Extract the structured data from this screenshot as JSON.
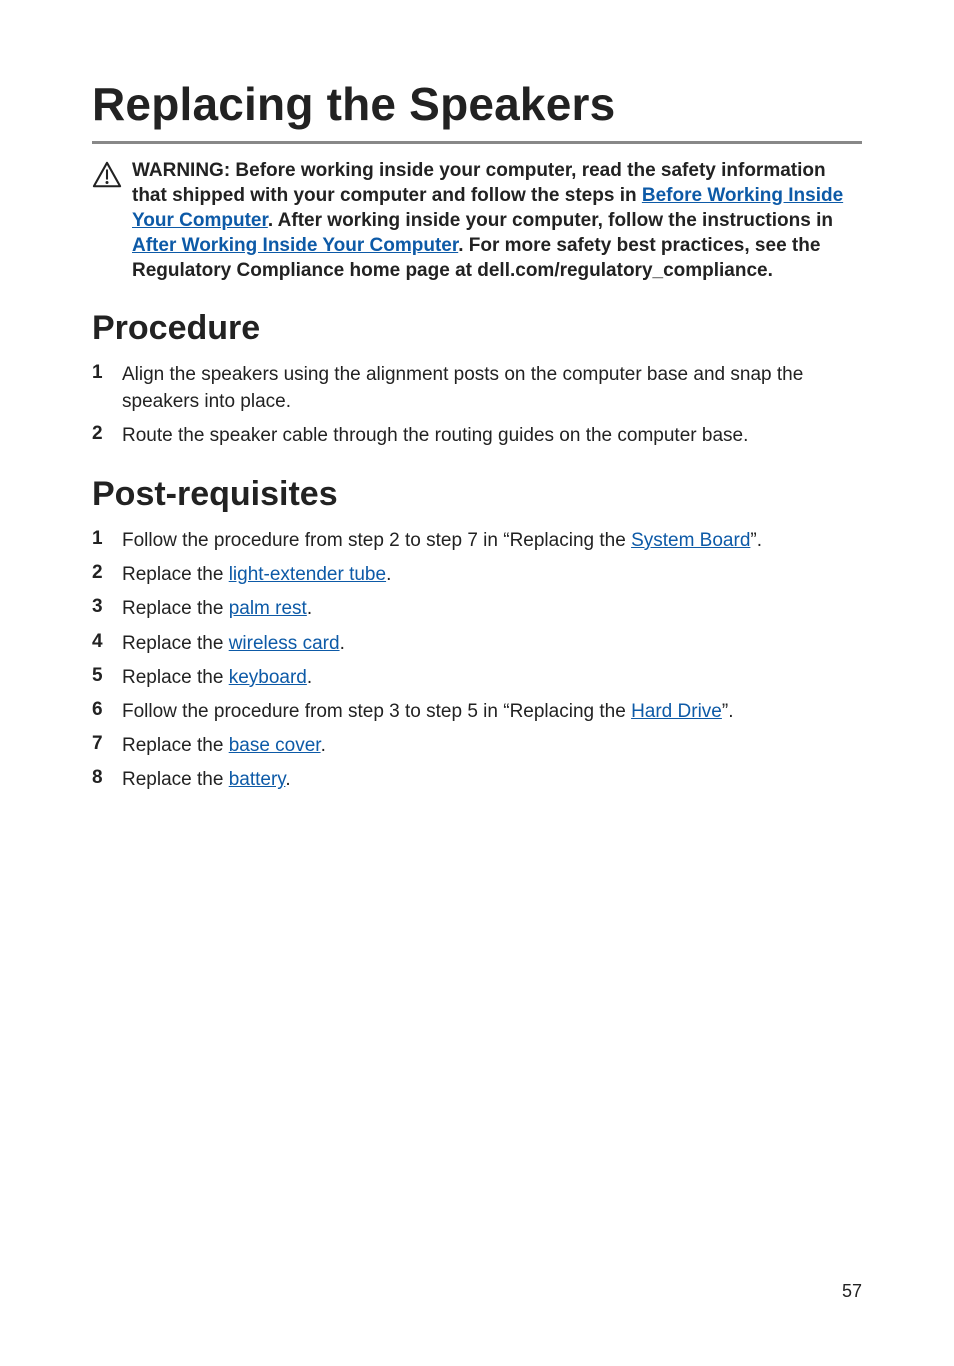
{
  "title": "Replacing the Speakers",
  "warning": {
    "pre1": "WARNING: Before working inside your computer, read the safety information that shipped with your computer and follow the steps in ",
    "link1": "Before Working Inside Your Computer",
    "mid1": ". After working inside your computer, follow the instructions in ",
    "link2": "After Working Inside Your Computer",
    "post1": ". For more safety best practices, see the Regulatory Compliance home page at dell.com/regulatory_compliance."
  },
  "sections": {
    "procedure": {
      "heading": "Procedure",
      "items": [
        {
          "num": "1",
          "text": "Align the speakers using the alignment posts on the computer base and snap the speakers into place."
        },
        {
          "num": "2",
          "text": "Route the speaker cable through the routing guides on the computer base."
        }
      ]
    },
    "post": {
      "heading": "Post-requisites",
      "items": [
        {
          "num": "1",
          "pre": "Follow the procedure from step 2 to step 7 in “Replacing the ",
          "link": "System Board",
          "post": "”."
        },
        {
          "num": "2",
          "pre": "Replace the ",
          "link": "light-extender tube",
          "post": "."
        },
        {
          "num": "3",
          "pre": "Replace the ",
          "link": "palm rest",
          "post": "."
        },
        {
          "num": "4",
          "pre": "Replace the ",
          "link": "wireless card",
          "post": "."
        },
        {
          "num": "5",
          "pre": "Replace the ",
          "link": "keyboard",
          "post": "."
        },
        {
          "num": "6",
          "pre": "Follow the procedure from step 3 to step 5 in “Replacing the ",
          "link": "Hard Drive",
          "post": "”."
        },
        {
          "num": "7",
          "pre": "Replace the ",
          "link": "base cover",
          "post": "."
        },
        {
          "num": "8",
          "pre": "Replace the ",
          "link": "battery",
          "post": "."
        }
      ]
    }
  },
  "page_number": "57"
}
